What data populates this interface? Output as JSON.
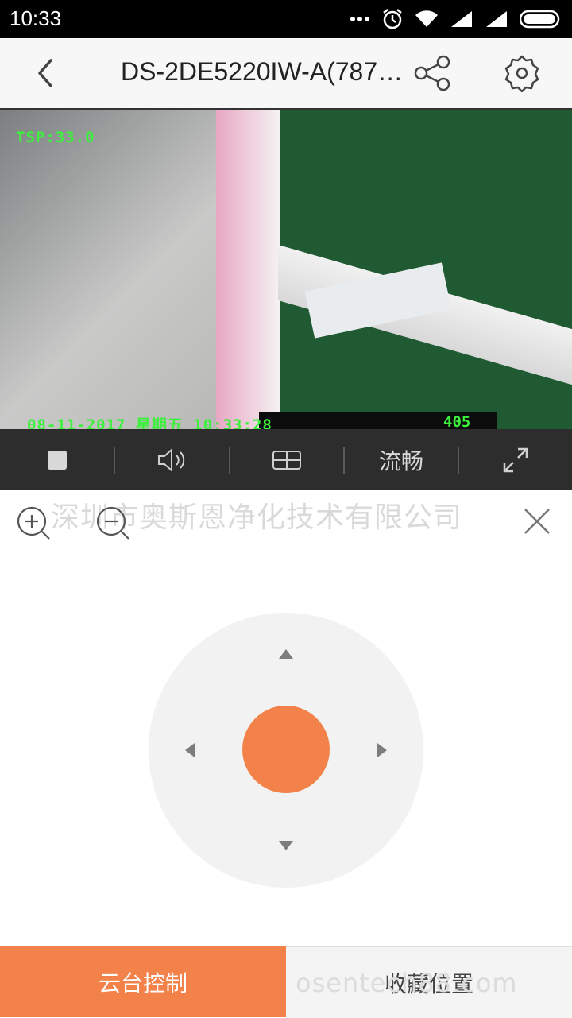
{
  "status_bar": {
    "time": "10:33",
    "icons": [
      "more-dots-icon",
      "alarm-icon",
      "wifi-icon",
      "signal-icon",
      "signal-icon",
      "battery-icon"
    ]
  },
  "header": {
    "title": "DS-2DE5220IW-A(787…",
    "back_icon": "chevron-left-icon",
    "share_icon": "share-icon",
    "settings_icon": "gear-icon"
  },
  "video": {
    "osd_top": "TSP:33.0",
    "osd_bottom": "08-11-2017 星期五 10:33:28",
    "osd_right": "405"
  },
  "toolbar": {
    "stop_icon": "stop-icon",
    "sound_icon": "speaker-icon",
    "layout_icon": "grid-icon",
    "quality_label": "流畅",
    "fullscreen_icon": "fullscreen-icon"
  },
  "controls": {
    "watermark": "深圳市奥斯恩净化技术有限公司",
    "zoom_in_icon": "zoom-in-icon",
    "zoom_out_icon": "zoom-out-icon",
    "close_icon": "close-icon"
  },
  "colors": {
    "accent": "#f2824a",
    "toolbar_bg": "#2d2d2d"
  },
  "tabs": {
    "ptz_label": "云台控制",
    "favorites_label": "收藏位置",
    "watermark": "osentech88.com"
  }
}
